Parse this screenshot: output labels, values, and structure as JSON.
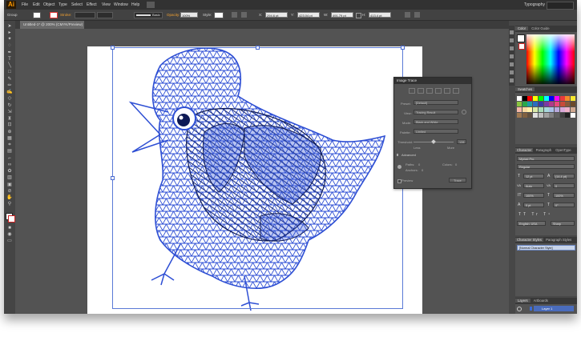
{
  "app": {
    "logo": "Ai",
    "workspace": "Typography"
  },
  "menu": [
    "File",
    "Edit",
    "Object",
    "Type",
    "Select",
    "Effect",
    "View",
    "Window",
    "Help"
  ],
  "control_bar": {
    "group_label": "Group",
    "stroke_label": "Stroke:",
    "brush_value": "Basic",
    "opacity_label": "Opacity:",
    "opacity_value": "100%",
    "style_label": "Style:",
    "x_value": "294.6 pt",
    "y_value": "423.04 pt",
    "w_value": "491.79 pt",
    "h_value": "413.4 pt"
  },
  "document_tab": "Untitled-1* @ 200% (CMYK/Preview)",
  "tools": [
    "arrow",
    "direct",
    "wand",
    "lasso",
    "pen",
    "type",
    "line",
    "rect",
    "brush",
    "pencil",
    "blob",
    "eraser",
    "rotate",
    "scale",
    "width",
    "free",
    "shape",
    "persp",
    "mesh",
    "grad",
    "eyedrop",
    "blend",
    "symbol",
    "graph",
    "artboard",
    "slice",
    "hand",
    "zoom"
  ],
  "image_trace": {
    "title": "Image Trace",
    "preset_label": "Preset:",
    "preset_value": "[Default]",
    "view_label": "View:",
    "view_value": "Tracing Result",
    "mode_label": "Mode:",
    "mode_value": "Black and White",
    "palette_label": "Palette:",
    "palette_value": "Limited",
    "threshold_label": "Threshold:",
    "threshold_value": "128",
    "less_label": "Less",
    "more_label": "More",
    "advanced_label": "Advanced",
    "paths_label": "Paths:",
    "paths_value": "0",
    "colors_label": "Colors:",
    "colors_value": "0",
    "anchors_label": "Anchors:",
    "anchors_value": "0",
    "preview_label": "Preview",
    "trace_button": "Trace"
  },
  "color_panel": {
    "tab1": "Color",
    "tab2": "Color Guide"
  },
  "swatches_panel": {
    "tab1": "Swatches"
  },
  "character_panel": {
    "tab1": "Character",
    "tab2": "Paragraph",
    "tab3": "OpenType",
    "font_family": "Myriad Pro",
    "font_style": "Regular",
    "size": "12 pt",
    "leading": "(14.4 pt)",
    "kerning": "Auto",
    "tracking": "0",
    "v_scale": "100%",
    "h_scale": "100%",
    "baseline": "0 pt",
    "rotation": "0°",
    "language": "English: USA",
    "antialias": "Sharp"
  },
  "char_styles_panel": {
    "tab1": "Character Styles",
    "tab2": "Paragraph Styles",
    "item": "[Normal Character Style]"
  },
  "layers_panel": {
    "tab1": "Layers",
    "tab2": "Artboards",
    "layer_name": "Layer 1"
  },
  "colors": {
    "bird_line": "#2e4fd4",
    "bird_dark": "#0e1a55",
    "selection": "#5a7ad6",
    "ui_dark": "#323232",
    "ui_mid": "#535353"
  }
}
